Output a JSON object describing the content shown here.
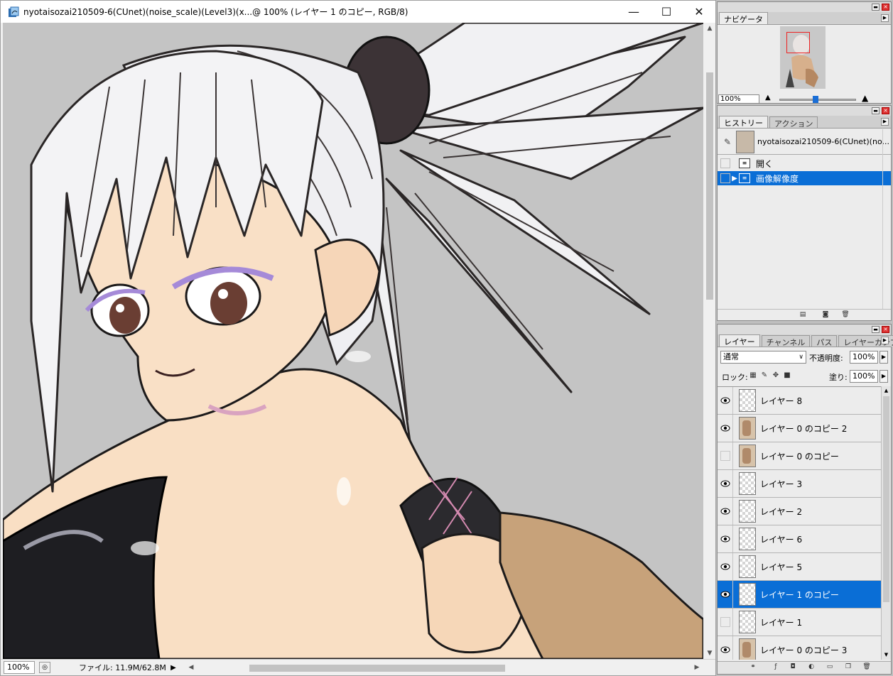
{
  "document": {
    "title": "nyotaisozai210509-6(CUnet)(noise_scale)(Level3)(x...@ 100% (レイヤー 1 のコピー, RGB/8)",
    "window_controls": {
      "minimize": "—",
      "maximize": "☐",
      "close": "✕"
    },
    "status": {
      "zoom": "100%",
      "file_info": "ファイル: 11.9M/62.8M"
    }
  },
  "navigator": {
    "tab": "ナビゲータ",
    "zoom": "100%",
    "zoom_slider_fraction": 0.5
  },
  "history": {
    "tabs": [
      "ヒストリー",
      "アクション"
    ],
    "snapshot_label": "nyotaisozai210509-6(CUnet)(no...",
    "steps": [
      {
        "label": "開く",
        "selected": false
      },
      {
        "label": "画像解像度",
        "selected": true
      }
    ]
  },
  "layers": {
    "tabs": [
      "レイヤー",
      "チャンネル",
      "パス",
      "レイヤーカンプ"
    ],
    "blend_mode": "通常",
    "opacity_label": "不透明度:",
    "opacity": "100%",
    "lock_label": "ロック:",
    "fill_label": "塗り:",
    "fill": "100%",
    "items": [
      {
        "name": "レイヤー 8",
        "visible": true,
        "thumb": "transparent",
        "selected": false
      },
      {
        "name": "レイヤー 0 のコピー 2",
        "visible": true,
        "thumb": "art",
        "selected": false
      },
      {
        "name": "レイヤー 0 のコピー",
        "visible": false,
        "thumb": "art",
        "selected": false
      },
      {
        "name": "レイヤー 3",
        "visible": true,
        "thumb": "transparent",
        "selected": false
      },
      {
        "name": "レイヤー 2",
        "visible": true,
        "thumb": "transparent",
        "selected": false
      },
      {
        "name": "レイヤー 6",
        "visible": true,
        "thumb": "transparent",
        "selected": false
      },
      {
        "name": "レイヤー 5",
        "visible": true,
        "thumb": "transparent",
        "selected": false
      },
      {
        "name": "レイヤー 1 のコピー",
        "visible": true,
        "thumb": "transparent",
        "selected": true
      },
      {
        "name": "レイヤー 1",
        "visible": false,
        "thumb": "transparent",
        "selected": false
      },
      {
        "name": "レイヤー 0 のコピー 3",
        "visible": true,
        "thumb": "art",
        "selected": false
      }
    ]
  },
  "colors": {
    "selection": "#0a6ed6",
    "canvas_bg": "#c4c4c4",
    "skin": "#f7dcc0",
    "hair": "#f2f2f4",
    "garment": "#1e1e22"
  }
}
